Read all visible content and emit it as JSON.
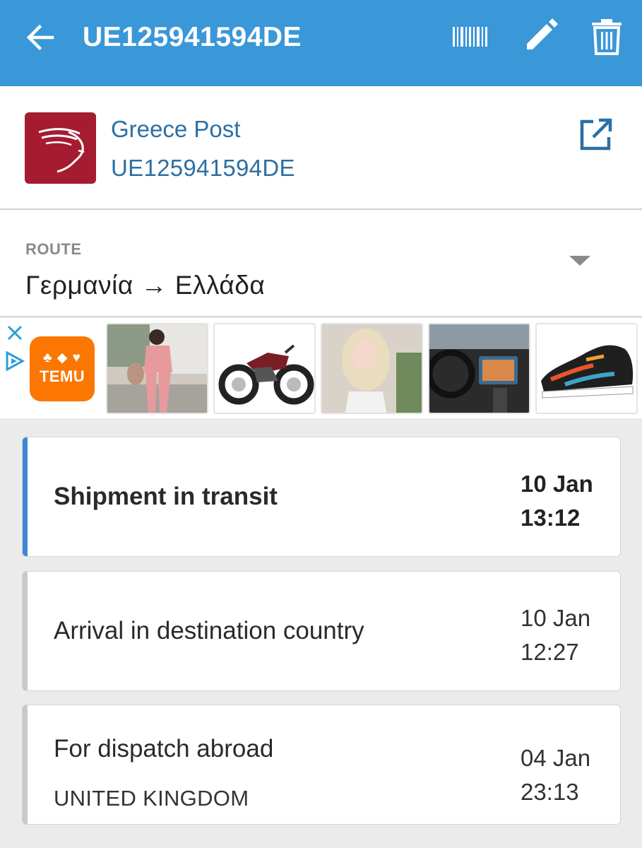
{
  "appbar": {
    "title": "UE125941594DE",
    "icons": [
      "back-arrow-icon",
      "barcode-icon",
      "edit-pencil-icon",
      "trash-icon"
    ]
  },
  "carrier": {
    "name": "Greece Post",
    "tracking_number": "UE125941594DE",
    "logo_color": "#a51c30",
    "link_color": "#2c6fa3"
  },
  "route": {
    "label": "ROUTE",
    "value": "Γερμανία → Ελλάδα"
  },
  "ad": {
    "brand": "TEMU",
    "brand_color": "#fb7701",
    "thumbnails": [
      "pink-outfit-photo",
      "motorcycle-photo",
      "blonde-wig-photo",
      "car-interior-photo",
      "sneaker-photo"
    ]
  },
  "events": [
    {
      "title": "Shipment in transit",
      "subtitle": "",
      "date": "10 Jan",
      "time": "13:12",
      "active": true
    },
    {
      "title": "Arrival in destination country",
      "subtitle": "",
      "date": "10 Jan",
      "time": "12:27",
      "active": false
    },
    {
      "title": "For dispatch abroad",
      "subtitle": "UNITED KINGDOM",
      "date": "04 Jan",
      "time": "23:13",
      "active": false
    }
  ],
  "colors": {
    "appbar": "#3a97d8",
    "active_accent": "#3a87d6",
    "background": "#ebebeb"
  }
}
